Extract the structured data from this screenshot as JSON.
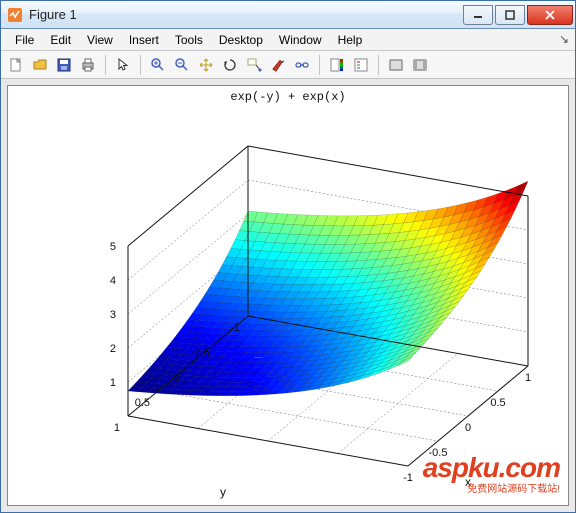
{
  "window": {
    "title": "Figure 1",
    "buttons": {
      "min": "–",
      "max": "□",
      "close": "×"
    }
  },
  "menu": {
    "items": [
      "File",
      "Edit",
      "View",
      "Insert",
      "Tools",
      "Desktop",
      "Window",
      "Help"
    ],
    "handle": "↘"
  },
  "toolbar_icons": [
    "new-icon",
    "open-icon",
    "save-icon",
    "print-icon",
    "sep",
    "pointer-icon",
    "sep",
    "zoom-in-icon",
    "zoom-out-icon",
    "pan-icon",
    "rotate-icon",
    "data-cursor-icon",
    "brush-icon",
    "link-icon",
    "sep",
    "colorbar-icon",
    "legend-icon",
    "sep",
    "hide-tools-icon",
    "show-tools-icon"
  ],
  "chart_data": {
    "type": "surface3d",
    "title": "exp(-y) + exp(x)",
    "expression": "exp(-y) + exp(x)",
    "xlabel": "x",
    "ylabel": "y",
    "zlabel": "",
    "x_range": [
      -1,
      1
    ],
    "y_range": [
      -1,
      1
    ],
    "z_range": [
      0,
      5
    ],
    "x_ticks": [
      -1,
      -0.5,
      0,
      0.5,
      1
    ],
    "y_ticks": [
      -1,
      -0.5,
      0,
      0.5,
      1
    ],
    "z_ticks": [
      1,
      2,
      3,
      4,
      5
    ],
    "corner_values": {
      "x_-1_y_-1": 3.09,
      "x_1_y_-1": 5.44,
      "x_-1_y_1": 0.74,
      "x_1_y_1": 3.09
    },
    "colormap": "jet",
    "view": {
      "az": -37.5,
      "el": 30
    }
  },
  "watermark": {
    "big": "aspku",
    "suffix": ".com",
    "small": "免费网站源码下载站!"
  }
}
